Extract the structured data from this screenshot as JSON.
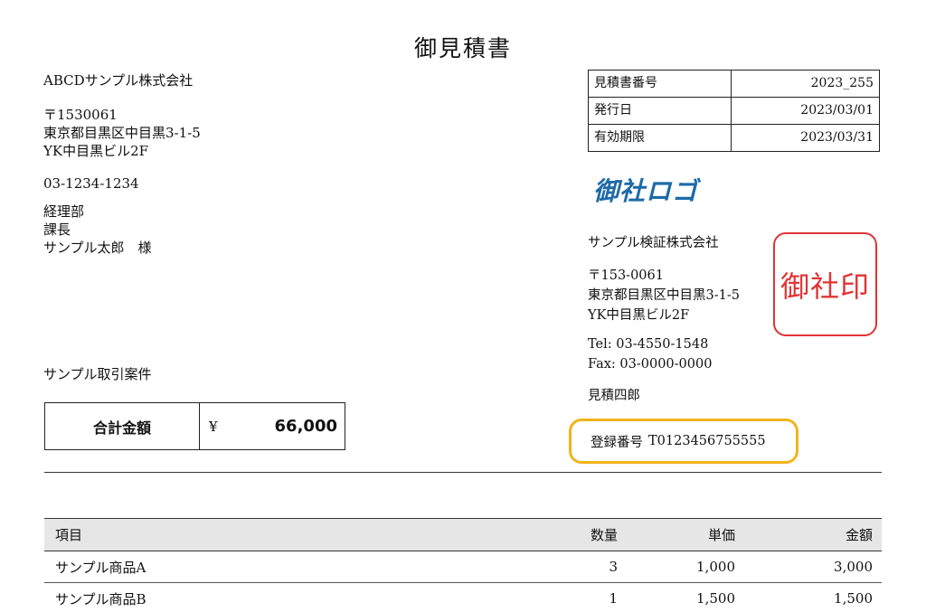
{
  "document": {
    "title": "御見積書"
  },
  "client": {
    "company": "ABCDサンプル株式会社",
    "postal": "〒1530061",
    "address1": "東京都目黒区中目黒3-1-5",
    "address2": "YK中目黒ビル2F",
    "phone": "03-1234-1234",
    "department": "経理部",
    "position": "課長",
    "name": "サンプル太郎　様"
  },
  "project": {
    "name": "サンプル取引案件"
  },
  "meta": {
    "rows": [
      {
        "label": "見積書番号",
        "value": "2023_255"
      },
      {
        "label": "発行日",
        "value": "2023/03/01"
      },
      {
        "label": "有効期限",
        "value": "2023/03/31"
      }
    ]
  },
  "logo": {
    "text": "御社ロゴ",
    "color": "#1d6aa8"
  },
  "issuer": {
    "company": "サンプル検証株式会社",
    "postal": "〒153-0061",
    "address1": "東京都目黒区中目黒3-1-5",
    "address2": "YK中目黒ビル2F",
    "tel": "Tel: 03-4550-1548",
    "fax": "Fax: 03-0000-0000",
    "person": "見積四郎",
    "registration_label": "登録番号",
    "registration_number": "T0123456755555",
    "highlight_color": "#f0b41c"
  },
  "stamp": {
    "text": "御社印",
    "color": "#e03434"
  },
  "total": {
    "label": "合計金額",
    "currency": "¥",
    "amount": "66,000"
  },
  "items": {
    "headers": {
      "name": "項目",
      "quantity": "数量",
      "unit_price": "単価",
      "amount": "金額"
    },
    "rows": [
      {
        "name": "サンプル商品A",
        "quantity": "3",
        "unit_price": "1,000",
        "amount": "3,000"
      },
      {
        "name": "サンプル商品B",
        "quantity": "1",
        "unit_price": "1,500",
        "amount": "1,500"
      }
    ]
  }
}
